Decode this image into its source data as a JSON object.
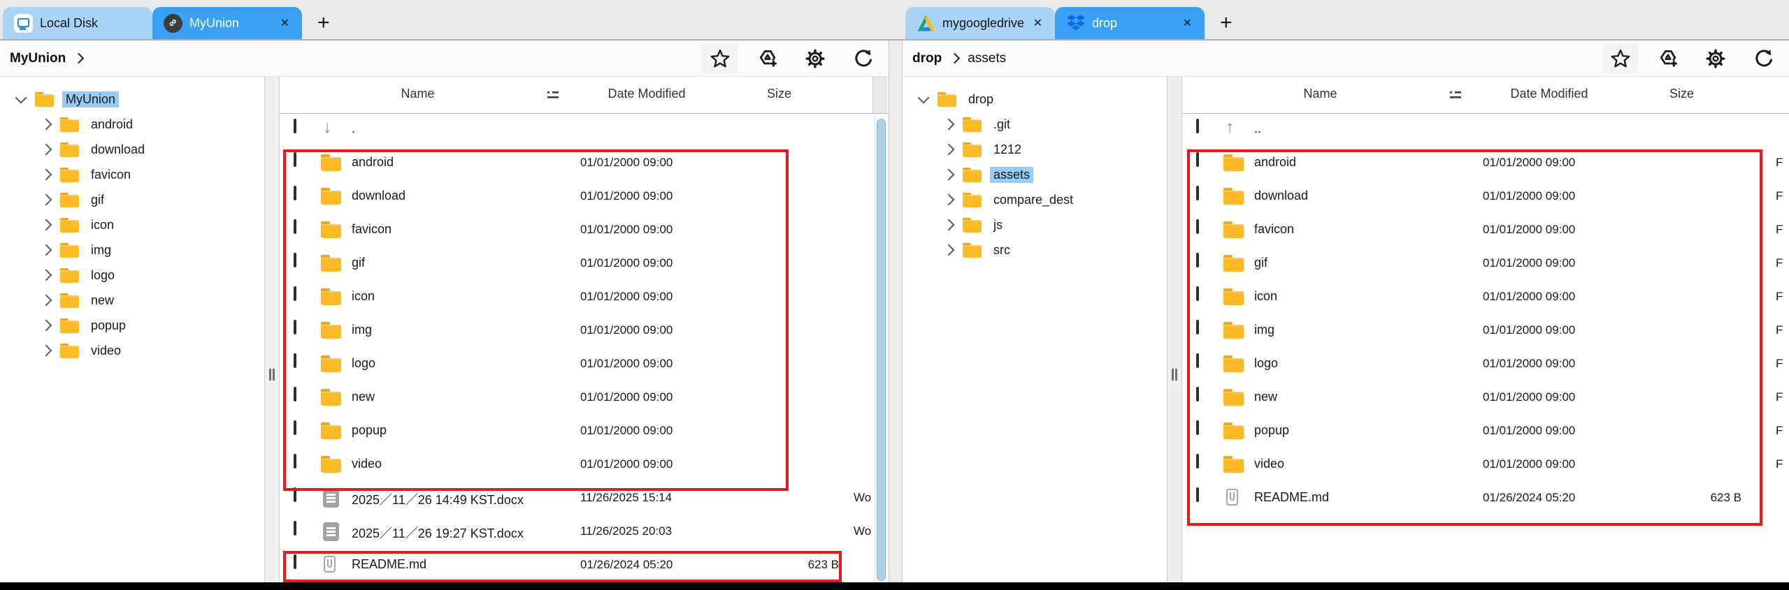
{
  "colors": {
    "accent_blue": "#3aa0f5",
    "tab_inactive_blue": "#a9d4f7",
    "selection_blue": "#94cbf7",
    "annotation_red": "#e8191c",
    "folder_yellow": "#fcba26",
    "scrollbar_blue": "#abd0ec"
  },
  "left": {
    "tabs": [
      {
        "label": "Local Disk",
        "icon": "local-disk-icon"
      },
      {
        "label": "MyUnion",
        "icon": "union-link-icon",
        "close": "✕"
      }
    ],
    "new_tab": "+",
    "breadcrumb": {
      "segments": [
        "MyUnion"
      ]
    },
    "toolbar": {
      "favorite": "star-icon",
      "add_drive": "add-drive-icon",
      "settings": "gear-icon",
      "refresh": "refresh-icon"
    },
    "tree": {
      "root": {
        "label": "MyUnion",
        "state": "sel"
      },
      "children": [
        {
          "label": "android",
          "state": ""
        },
        {
          "label": "download",
          "state": ""
        },
        {
          "label": "favicon",
          "state": ""
        },
        {
          "label": "gif",
          "state": ""
        },
        {
          "label": "icon",
          "state": ""
        },
        {
          "label": "img",
          "state": ""
        },
        {
          "label": "logo",
          "state": ""
        },
        {
          "label": "new",
          "state": ""
        },
        {
          "label": "popup",
          "state": ""
        },
        {
          "label": "video",
          "state": ""
        }
      ]
    },
    "list": {
      "columns": [
        "Name",
        "Date Modified",
        "Size"
      ],
      "sort_icon": "sort-order-icon",
      "rows": [
        {
          "icon": "ic-down",
          "name": ".",
          "date": "",
          "size": "",
          "kind": ""
        },
        {
          "icon": "ic-folder",
          "name": "android",
          "date": "01/01/2000 09:00",
          "size": "",
          "kind": ""
        },
        {
          "icon": "ic-folder",
          "name": "download",
          "date": "01/01/2000 09:00",
          "size": "",
          "kind": ""
        },
        {
          "icon": "ic-folder",
          "name": "favicon",
          "date": "01/01/2000 09:00",
          "size": "",
          "kind": ""
        },
        {
          "icon": "ic-folder",
          "name": "gif",
          "date": "01/01/2000 09:00",
          "size": "",
          "kind": ""
        },
        {
          "icon": "ic-folder",
          "name": "icon",
          "date": "01/01/2000 09:00",
          "size": "",
          "kind": ""
        },
        {
          "icon": "ic-folder",
          "name": "img",
          "date": "01/01/2000 09:00",
          "size": "",
          "kind": ""
        },
        {
          "icon": "ic-folder",
          "name": "logo",
          "date": "01/01/2000 09:00",
          "size": "",
          "kind": ""
        },
        {
          "icon": "ic-folder",
          "name": "new",
          "date": "01/01/2000 09:00",
          "size": "",
          "kind": ""
        },
        {
          "icon": "ic-folder",
          "name": "popup",
          "date": "01/01/2000 09:00",
          "size": "",
          "kind": ""
        },
        {
          "icon": "ic-folder",
          "name": "video",
          "date": "01/01/2000 09:00",
          "size": "",
          "kind": ""
        },
        {
          "icon": "ic-word",
          "name": "2025／11／26 14:49 KST.docx",
          "date": "11/26/2025 15:14",
          "size": "",
          "kind": "Wo"
        },
        {
          "icon": "ic-word",
          "name": "2025／11／26 19:27 KST.docx",
          "date": "11/26/2025 20:03",
          "size": "",
          "kind": "Wo"
        },
        {
          "icon": "ic-readme",
          "name": "README.md",
          "date": "01/26/2024 05:20",
          "size": "623 B",
          "kind": ""
        }
      ]
    }
  },
  "right": {
    "tabs": [
      {
        "label": "mygoogledrive",
        "icon": "google-drive-icon",
        "close": "✕"
      },
      {
        "label": "drop",
        "icon": "dropbox-icon",
        "close": "✕"
      }
    ],
    "new_tab": "+",
    "breadcrumb": {
      "segments": [
        "drop",
        "assets"
      ]
    },
    "toolbar": {
      "favorite": "star-icon",
      "add_drive": "add-drive-icon",
      "settings": "gear-icon",
      "refresh": "refresh-icon"
    },
    "tree": {
      "root": {
        "label": "drop",
        "state": ""
      },
      "children": [
        {
          "label": ".git",
          "state": ""
        },
        {
          "label": "1212",
          "state": ""
        },
        {
          "label": "assets",
          "state": "sel"
        },
        {
          "label": "compare_dest",
          "state": ""
        },
        {
          "label": "js",
          "state": ""
        },
        {
          "label": "src",
          "state": ""
        }
      ]
    },
    "list": {
      "columns": [
        "Name",
        "Date Modified",
        "Size"
      ],
      "sort_icon": "sort-order-icon",
      "rows": [
        {
          "icon": "ic-up",
          "name": "..",
          "date": "",
          "size": "",
          "kind": ""
        },
        {
          "icon": "ic-folder",
          "name": "android",
          "date": "01/01/2000 09:00",
          "size": "",
          "kind": "F"
        },
        {
          "icon": "ic-folder",
          "name": "download",
          "date": "01/01/2000 09:00",
          "size": "",
          "kind": "F"
        },
        {
          "icon": "ic-folder",
          "name": "favicon",
          "date": "01/01/2000 09:00",
          "size": "",
          "kind": "F"
        },
        {
          "icon": "ic-folder",
          "name": "gif",
          "date": "01/01/2000 09:00",
          "size": "",
          "kind": "F"
        },
        {
          "icon": "ic-folder",
          "name": "icon",
          "date": "01/01/2000 09:00",
          "size": "",
          "kind": "F"
        },
        {
          "icon": "ic-folder",
          "name": "img",
          "date": "01/01/2000 09:00",
          "size": "",
          "kind": "F"
        },
        {
          "icon": "ic-folder",
          "name": "logo",
          "date": "01/01/2000 09:00",
          "size": "",
          "kind": "F"
        },
        {
          "icon": "ic-folder",
          "name": "new",
          "date": "01/01/2000 09:00",
          "size": "",
          "kind": "F"
        },
        {
          "icon": "ic-folder",
          "name": "popup",
          "date": "01/01/2000 09:00",
          "size": "",
          "kind": "F"
        },
        {
          "icon": "ic-folder",
          "name": "video",
          "date": "01/01/2000 09:00",
          "size": "",
          "kind": "F"
        },
        {
          "icon": "ic-readme",
          "name": "README.md",
          "date": "01/26/2024 05:20",
          "size": "623 B",
          "kind": ""
        }
      ]
    }
  }
}
